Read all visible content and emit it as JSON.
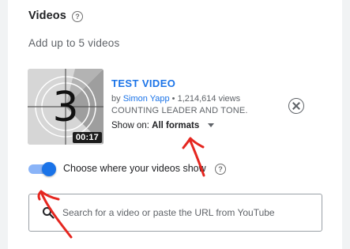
{
  "section": {
    "title": "Videos",
    "subtitle": "Add up to 5 videos"
  },
  "video": {
    "title": "TEST VIDEO",
    "by_prefix": "by",
    "channel": "Simon Yapp",
    "separator": "•",
    "views": "1,214,614 views",
    "description": "COUNTING LEADER AND TONE.",
    "duration": "00:17",
    "thumbnail_digit": "3",
    "show_on_label": "Show on:",
    "show_on_value": "All formats"
  },
  "toggle": {
    "label": "Choose where your videos show",
    "enabled": true
  },
  "search": {
    "placeholder": "Search for a video or paste the URL from YouTube",
    "value": ""
  },
  "icons": {
    "help": "help-circle-icon",
    "remove": "close-circle-icon",
    "search": "search-icon",
    "dropdown": "caret-down-icon"
  },
  "colors": {
    "accent": "#1a73e8",
    "annotation": "#e5261f"
  }
}
